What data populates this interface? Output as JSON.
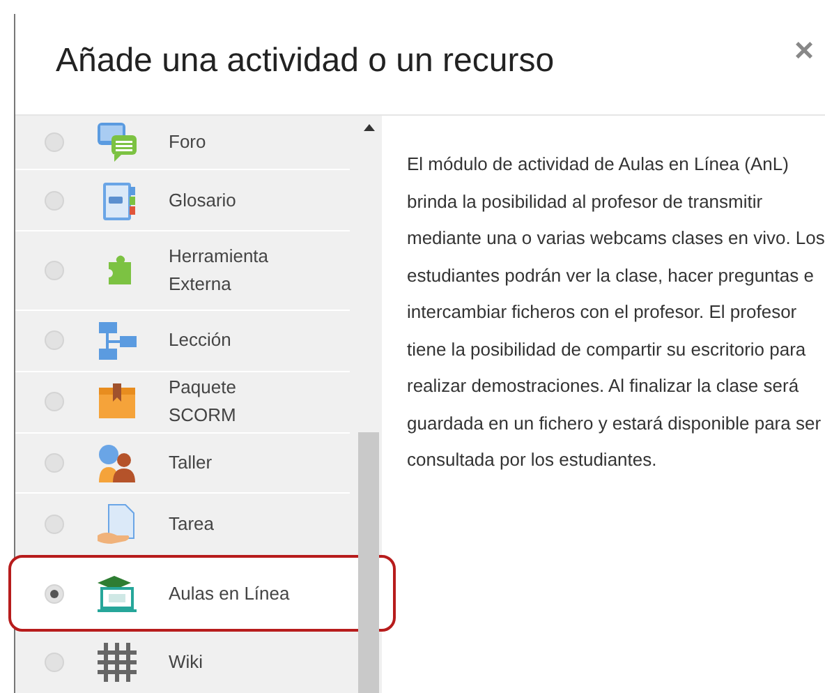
{
  "dialog": {
    "title": "Añade una actividad o un recurso",
    "close": "×"
  },
  "options": [
    {
      "label": "Foro",
      "kind": "forum",
      "selected": false
    },
    {
      "label": "Glosario",
      "kind": "glossary",
      "selected": false
    },
    {
      "label": "Herramienta Externa",
      "kind": "puzzle",
      "selected": false
    },
    {
      "label": "Lección",
      "kind": "lesson",
      "selected": false
    },
    {
      "label": "Paquete SCORM",
      "kind": "package",
      "selected": false
    },
    {
      "label": "Taller",
      "kind": "workshop",
      "selected": false
    },
    {
      "label": "Tarea",
      "kind": "assignment",
      "selected": false
    },
    {
      "label": "Aulas en Línea",
      "kind": "classroom",
      "selected": true
    },
    {
      "label": "Wiki",
      "kind": "wiki",
      "selected": false
    }
  ],
  "description": "El módulo de actividad de Aulas en Línea (AnL) brinda la posibilidad al profesor de transmitir mediante una o varias webcams clases en vivo. Los estudiantes podrán ver la clase, hacer preguntas e intercambiar ficheros con el profesor. El profesor tiene la posibilidad de compartir su escritorio para realizar demostraciones. Al finalizar la clase será guardada en un fichero y estará disponible para ser consultada por los estudiantes."
}
